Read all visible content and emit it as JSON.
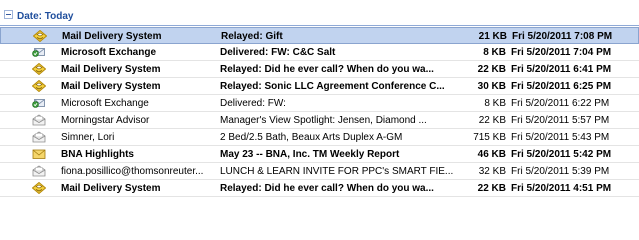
{
  "group": {
    "label": "Date: Today"
  },
  "messages": [
    {
      "from": "Mail Delivery System",
      "subject": "Relayed: Gift",
      "size": "21 KB",
      "received": "Fri 5/20/2011 7:08 PM",
      "icon": "relayed-icon",
      "unread": true,
      "selected": true
    },
    {
      "from": "Microsoft Exchange",
      "subject": "Delivered: FW: C&C Salt",
      "size": "8 KB",
      "received": "Fri 5/20/2011 7:04 PM",
      "icon": "delivered-icon",
      "unread": true,
      "selected": false
    },
    {
      "from": "Mail Delivery System",
      "subject": "Relayed: Did he ever call?  When do you wa...",
      "size": "22 KB",
      "received": "Fri 5/20/2011 6:41 PM",
      "icon": "relayed-icon",
      "unread": true,
      "selected": false
    },
    {
      "from": "Mail Delivery System",
      "subject": "Relayed: Sonic LLC Agreement Conference C...",
      "size": "30 KB",
      "received": "Fri 5/20/2011 6:25 PM",
      "icon": "relayed-icon",
      "unread": true,
      "selected": false
    },
    {
      "from": "Microsoft Exchange",
      "subject": "Delivered: FW:",
      "size": "8 KB",
      "received": "Fri 5/20/2011 6:22 PM",
      "icon": "delivered-icon",
      "unread": false,
      "selected": false
    },
    {
      "from": "Morningstar Advisor",
      "subject": "Manager's View Spotlight: Jensen, Diamond ...",
      "size": "22 KB",
      "received": "Fri 5/20/2011 5:57 PM",
      "icon": "read-envelope-icon",
      "unread": false,
      "selected": false
    },
    {
      "from": "Simner, Lori",
      "subject": "2 Bed/2.5 Bath, Beaux Arts Duplex      A-GM",
      "size": "715 KB",
      "received": "Fri 5/20/2011 5:43 PM",
      "icon": "read-envelope-icon",
      "unread": false,
      "selected": false
    },
    {
      "from": "BNA Highlights",
      "subject": "May  23 -- BNA, Inc. TM Weekly Report",
      "size": "46 KB",
      "received": "Fri 5/20/2011 5:42 PM",
      "icon": "unread-envelope-icon",
      "unread": true,
      "selected": false
    },
    {
      "from": "fiona.posillico@thomsonreuter...",
      "subject": "LUNCH & LEARN INVITE FOR PPC's SMART FIE...",
      "size": "32 KB",
      "received": "Fri 5/20/2011 5:39 PM",
      "icon": "read-envelope-icon",
      "unread": false,
      "selected": false
    },
    {
      "from": "Mail Delivery System",
      "subject": "Relayed: Did he ever call?  When do you wa...",
      "size": "22 KB",
      "received": "Fri 5/20/2011 4:51 PM",
      "icon": "relayed-icon",
      "unread": true,
      "selected": false
    }
  ]
}
